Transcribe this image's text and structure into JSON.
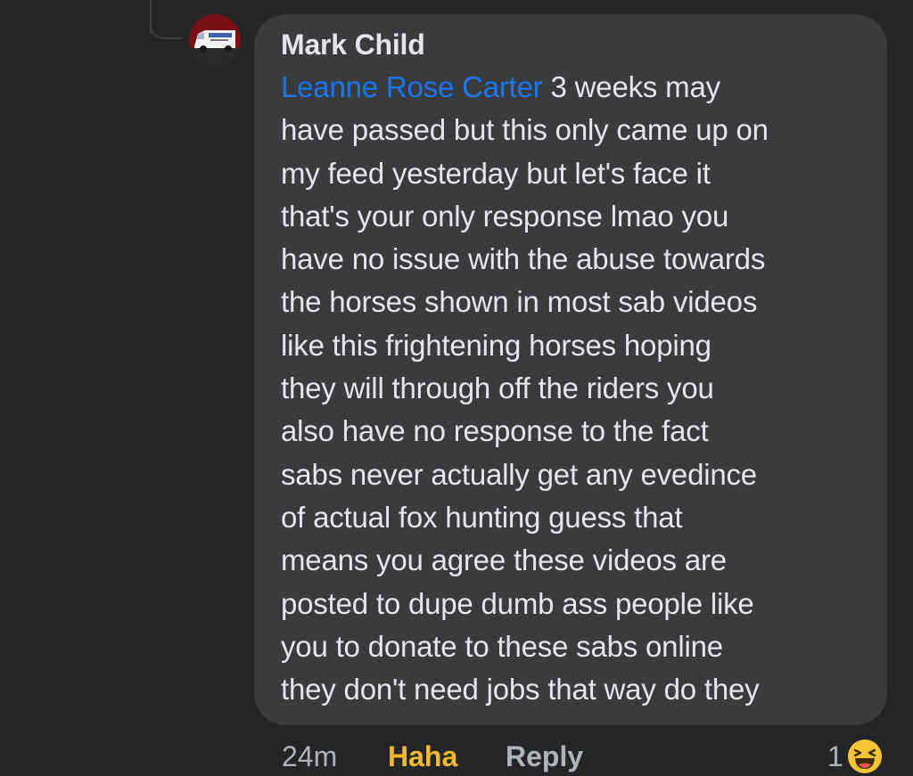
{
  "comment": {
    "author": "Mark Child",
    "mention": "Leanne Rose Carter",
    "text_first": " 3 weeks may",
    "lines": [
      "have passed but this only came up on",
      "my feed yesterday but let's face it",
      "that's your only response lmao you",
      "have no issue with the abuse towards",
      "the horses shown in most sab videos",
      "like this frightening horses hoping",
      "they will through off the riders you",
      "also have no response to the fact",
      "sabs never actually get any evedince",
      "of actual fox hunting guess that",
      "means you agree these videos are",
      "posted to dupe dumb ass people like",
      "you to donate to these sabs online",
      "they don't need jobs that way do they"
    ]
  },
  "actions": {
    "time": "24m",
    "haha_label": "Haha",
    "reply_label": "Reply",
    "reaction_count": "1",
    "reaction_icon": "haha-emoji-icon"
  },
  "colors": {
    "background": "#242526",
    "bubble": "#3a3b3c",
    "text": "#e4e6eb",
    "mention": "#1877f2",
    "haha": "#f7b928",
    "muted": "#b0b3b8",
    "avatar": "#7a1116"
  }
}
